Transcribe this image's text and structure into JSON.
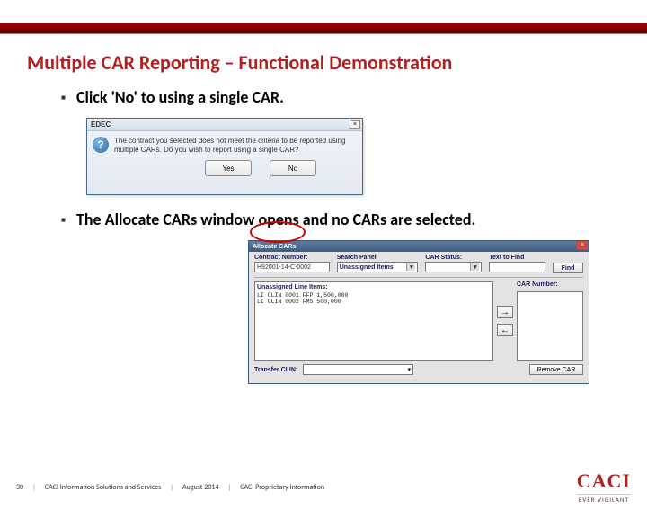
{
  "title": "Multiple CAR Reporting – Functional Demonstration",
  "bullets": {
    "b1": "Click 'No' to using a single CAR.",
    "b2": "The Allocate CARs window opens and no CARs are selected."
  },
  "dialog1": {
    "titlebar": "EDEC",
    "close": "×",
    "question_icon": "?",
    "message": "The contract you selected does not meet the criteria to be reported using multiple CARs. Do you wish to report using a single CAR?",
    "yes": "Yes",
    "no": "No"
  },
  "dialog2": {
    "titlebar": "Allocate CARs",
    "close": "×",
    "labels": {
      "contract": "Contract Number:",
      "search": "Search Panel",
      "text": "Text to Find",
      "uli": "Unassigned Line Items:",
      "carnum": "CAR Number:",
      "transfer": "Transfer CLIN:"
    },
    "contract_val": "H92001-14-C-0002",
    "search_field": "Unassigned Items",
    "find": "Find",
    "rows": [
      "LI   CLIN 0001        FFP   1,500,000",
      "LI   CLIN 0002        FMS     500,000"
    ],
    "arrow_right": "→",
    "arrow_left": "←",
    "remove": "Remove CAR"
  },
  "footer": {
    "page": "30",
    "org": "CACI Information Solutions and Services",
    "date": "August 2014",
    "class": "CACI Proprietary Information"
  },
  "logo": {
    "name": "CACI",
    "tag": "EVER VIGILANT"
  }
}
